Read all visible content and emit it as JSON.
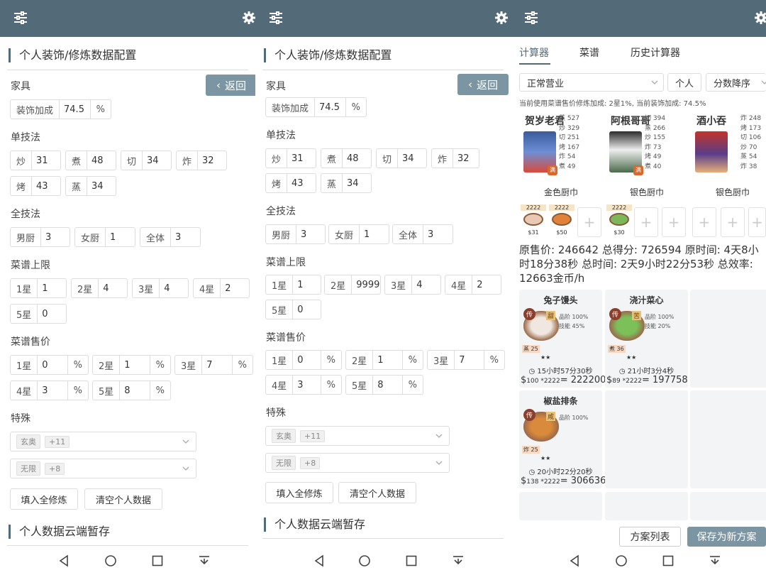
{
  "screen1": {
    "section_title": "个人装饰/修炼数据配置",
    "back_label": "返回",
    "furniture_label": "家具",
    "decor_label": "装饰加成",
    "decor_value": "74.5",
    "decor_unit": "%",
    "single_skill_label": "单技法",
    "chao_label": "炒",
    "chao_value": "31",
    "zhu_label": "煮",
    "zhu_value": "48",
    "qie_label": "切",
    "qie_value": "34",
    "zha_label": "炸",
    "zha_value": "32",
    "kao_label": "烤",
    "kao_value": "43",
    "zheng_label": "蒸",
    "zheng_value": "34",
    "all_skill_label": "全技法",
    "male_label": "男厨",
    "male_value": "3",
    "female_label": "女厨",
    "female_value": "1",
    "whole_label": "全体",
    "whole_value": "3",
    "cap_label": "菜谱上限",
    "cap1_label": "1星",
    "cap1_value": "1",
    "cap2_label": "2星",
    "cap2_value": "4",
    "cap3_label": "3星",
    "cap3_value": "4",
    "cap4_label": "4星",
    "cap4_value": "2",
    "cap5_label": "5星",
    "cap5_value": "0",
    "price_label": "菜谱售价",
    "price1_label": "1星",
    "price1_value": "0",
    "price2_label": "2星",
    "price2_value": "1",
    "price3_label": "3星",
    "price3_value": "7",
    "price4_label": "4星",
    "price4_value": "3",
    "price5_label": "5星",
    "price5_value": "8",
    "pct": "%",
    "special_label": "特殊",
    "special1_tag": "玄奥",
    "special1_value": "+11",
    "special2_tag": "无限",
    "special2_value": "+8",
    "fill_button": "填入全修炼",
    "clear_button": "清空个人数据",
    "cloud_title": "个人数据云端暂存"
  },
  "screen2": {
    "section_title": "个人装饰/修炼数据配置",
    "back_label": "返回",
    "furniture_label": "家具",
    "decor_label": "装饰加成",
    "decor_value": "74.5",
    "decor_unit": "%",
    "single_skill_label": "单技法",
    "chao_label": "炒",
    "chao_value": "31",
    "zhu_label": "煮",
    "zhu_value": "48",
    "qie_label": "切",
    "qie_value": "34",
    "zha_label": "炸",
    "zha_value": "32",
    "kao_label": "烤",
    "kao_value": "43",
    "zheng_label": "蒸",
    "zheng_value": "34",
    "all_skill_label": "全技法",
    "male_label": "男厨",
    "male_value": "3",
    "female_label": "女厨",
    "female_value": "1",
    "whole_label": "全体",
    "whole_value": "3",
    "cap_label": "菜谱上限",
    "cap1_label": "1星",
    "cap1_value": "1",
    "cap2_label": "2星",
    "cap2_value": "9999",
    "cap3_label": "3星",
    "cap3_value": "4",
    "cap4_label": "4星",
    "cap4_value": "2",
    "cap5_label": "5星",
    "cap5_value": "0",
    "price_label": "菜谱售价",
    "price1_label": "1星",
    "price1_value": "0",
    "price2_label": "2星",
    "price2_value": "1",
    "price3_label": "3星",
    "price3_value": "7",
    "price4_label": "4星",
    "price4_value": "3",
    "price5_label": "5星",
    "price5_value": "8",
    "pct": "%",
    "special_label": "特殊",
    "special1_tag": "玄奥",
    "special1_value": "+11",
    "special2_tag": "无限",
    "special2_value": "+8",
    "fill_button": "填入全修炼",
    "clear_button": "清空个人数据",
    "cloud_title": "个人数据云端暂存"
  },
  "screen3": {
    "tabs": [
      "计算器",
      "菜谱",
      "历史计算器"
    ],
    "mode_select": "正常营业",
    "person_select": "个人",
    "sort_select": "分数降序",
    "note": "当前使用菜谱售价修炼加成: 2星1%, 当前装饰加成: 74.5%",
    "chefs": [
      {
        "name": "贺岁老君",
        "stats": [
          "蒸 527",
          "炒 329",
          "切 251",
          "烤 167",
          "炸 54",
          "煮 49"
        ],
        "badge": "满"
      },
      {
        "name": "阿根哥哥",
        "stats": [
          "切 394",
          "蒸 266",
          "炒 155",
          "炸 73",
          "烤 49",
          "煮 40"
        ],
        "badge": "满"
      },
      {
        "name": "酒小吞",
        "stats": [
          "炸 248",
          "烤 173",
          "切 106",
          "炒 70",
          "蒸 54",
          "炸 38"
        ],
        "badge": ""
      }
    ],
    "ranks": [
      "金色厨巾",
      "银色厨巾",
      "银色厨巾"
    ],
    "kitchen_items": [
      {
        "count": "2222",
        "price": "$31"
      },
      {
        "count": "2222",
        "price": "$50"
      },
      {
        "count": "2222",
        "price": "$30"
      }
    ],
    "summary": "原售价: 246642 总得分: 726594 原时间: 4天8小时18分38秒 总时间: 2天9小时22分53秒 总效率: 12663金币/h",
    "dishes": [
      {
        "name": "兔子馒头",
        "level": "传",
        "flavor": "甜",
        "req1": "品阶 100%",
        "req2": "技能 45%",
        "tech": "蒸 25",
        "stars": "★★",
        "time": "15小时57分30秒",
        "price_small": "100 *2222",
        "price_big": "= 222200"
      },
      {
        "name": "浇汁菜心",
        "level": "传",
        "flavor": "苦",
        "req1": "品阶 100%",
        "req2": "技能 20%",
        "tech": "煮 36",
        "stars": "★★",
        "time": "21小时3分4秒",
        "price_small": "89 *2222",
        "price_big": "= 197758"
      },
      {
        "name": "椒盐排条",
        "level": "传",
        "flavor": "咸",
        "req1": "品阶 100%",
        "req2": "",
        "tech": "炸 25",
        "stars": "★★",
        "time": "20小时22分20秒",
        "price_small": "138 *2222",
        "price_big": "= 306636"
      }
    ],
    "plan_list_button": "方案列表",
    "save_plan_button": "保存为新方案"
  },
  "colors": {
    "header": "#536b78",
    "accent": "#7c95a3"
  }
}
